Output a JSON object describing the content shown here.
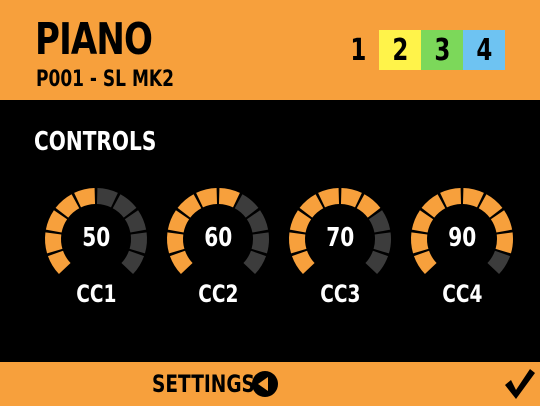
{
  "colors": {
    "accent": "#F7A03C",
    "background": "#000000",
    "knob_track": "#3C3C3C",
    "page_2": "#FFF34A",
    "page_3": "#7CD85A",
    "page_4": "#6EC3F2"
  },
  "header": {
    "title": "PIANO",
    "subtitle": "P001 - SL MK2"
  },
  "pages": [
    {
      "label": "1",
      "color": "#F7A03C",
      "active": true
    },
    {
      "label": "2",
      "color": "#FFF34A",
      "active": false
    },
    {
      "label": "3",
      "color": "#7CD85A",
      "active": false
    },
    {
      "label": "4",
      "color": "#6EC3F2",
      "active": false
    }
  ],
  "controls": {
    "title": "CONTROLS",
    "knobs": [
      {
        "label": "CC1",
        "value": "50",
        "level": 0.5
      },
      {
        "label": "CC2",
        "value": "60",
        "level": 0.6
      },
      {
        "label": "CC3",
        "value": "70",
        "level": 0.7
      },
      {
        "label": "CC4",
        "value": "90",
        "level": 0.9
      }
    ]
  },
  "footer": {
    "settings_label": "SETTINGS",
    "settings_icon": "circle-arrow-left-icon",
    "confirm_icon": "checkmark-icon"
  }
}
